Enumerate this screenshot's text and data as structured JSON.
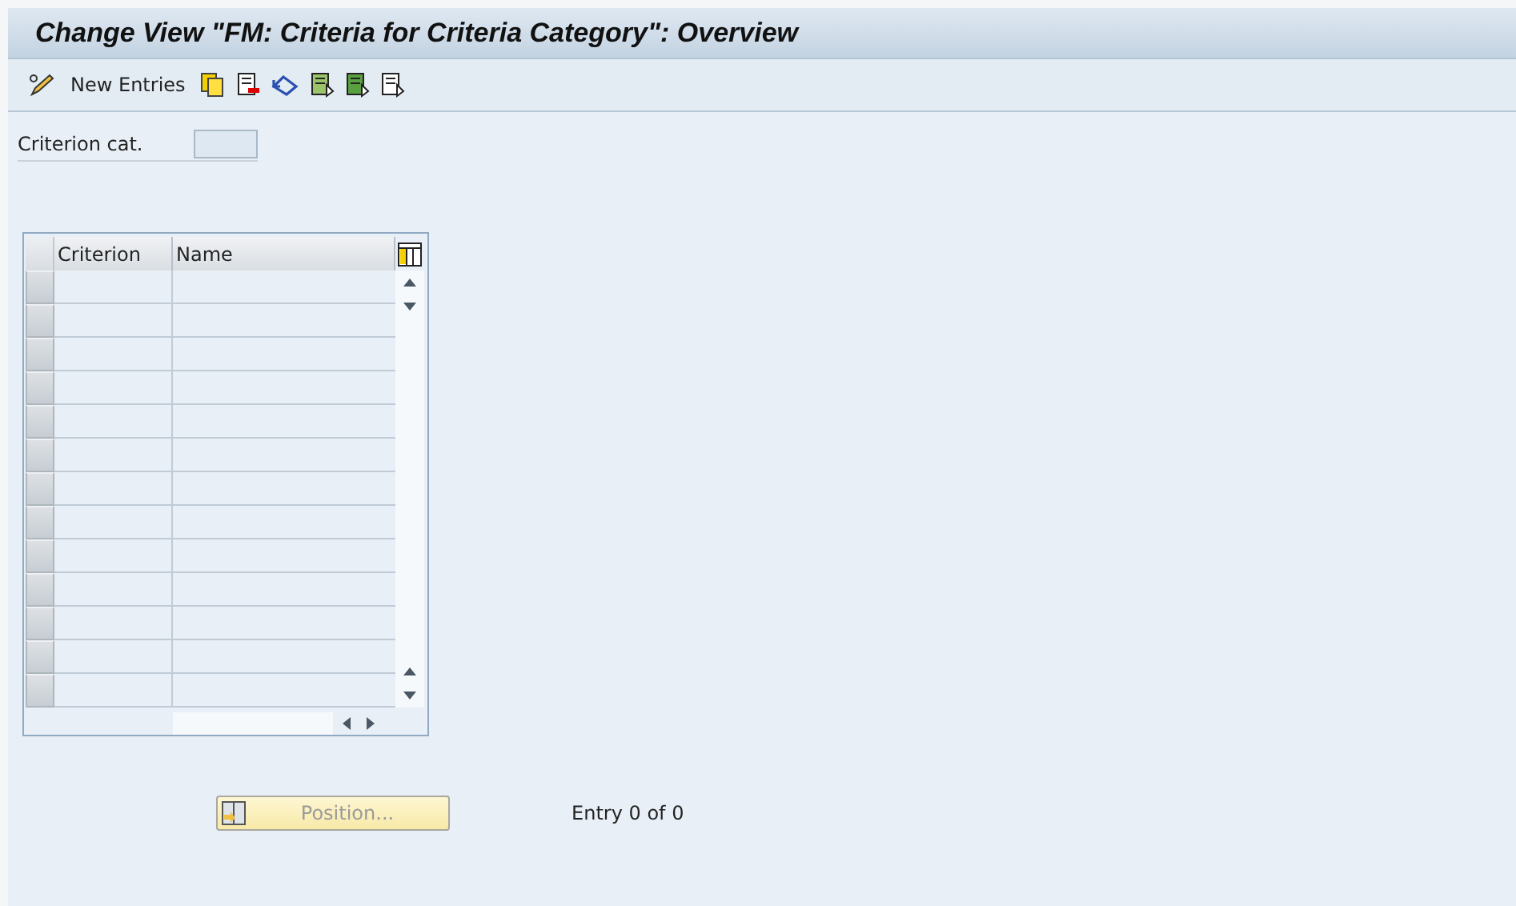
{
  "window": {
    "title": "Change View \"FM: Criteria for Criteria Category\": Overview"
  },
  "toolbar": {
    "new_entries": "New Entries"
  },
  "criterion_field": {
    "label": "Criterion cat."
  },
  "table": {
    "columns": [
      "Criterion",
      "Name"
    ]
  },
  "position_button": {
    "label": "Position...",
    "disabled": true
  },
  "entry_count": "Entry 0 of 0"
}
